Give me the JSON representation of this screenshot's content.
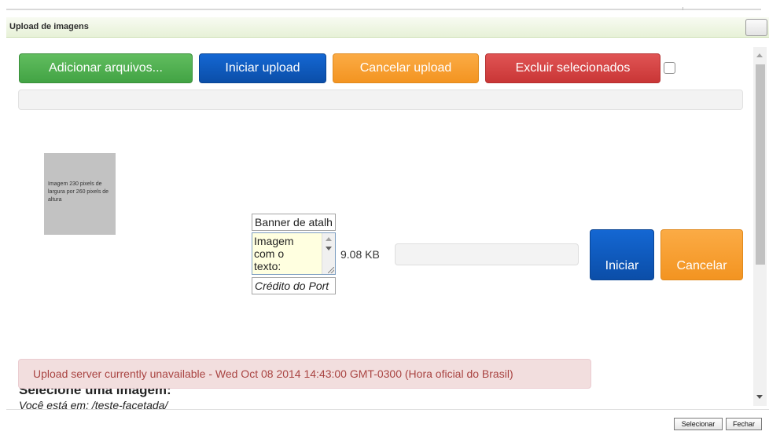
{
  "dialog": {
    "title": "Upload de imagens"
  },
  "toolbar": {
    "add_label": "Adicionar arquivos...",
    "start_label": "Iniciar upload",
    "cancel_label": "Cancelar upload",
    "delete_label": "Excluir selecionados",
    "select_all_checked": false
  },
  "file": {
    "thumbnail_text": "Imagem 230 pixels de largura por 260 pixels de altura",
    "title_value": "Banner de atalh",
    "description_value": "Imagem\ncom o\ntexto:",
    "credit_value": "Crédito do Port",
    "size": "9.08 KB",
    "progress": 0,
    "start_label": "Iniciar",
    "cancel_label": "Cancelar"
  },
  "alert": {
    "message": "Upload server currently unavailable - Wed Oct 08 2014 14:43:00 GMT-0300 (Hora oficial do Brasil)"
  },
  "background": {
    "heading": "Selecione uma imagem:",
    "location": "Você está em: /teste-facetada/"
  },
  "footer": {
    "select_label": "Selecionar",
    "close_label": "Fechar"
  },
  "colors": {
    "green": "#4cae4c",
    "blue": "#0e58bd",
    "orange": "#f89a2a",
    "red": "#d04242",
    "alert_bg": "#f2dede",
    "alert_text": "#a94442"
  },
  "icons": {
    "dialog_close": "square-close-icon",
    "scroll_up": "triangle-up-icon",
    "scroll_down": "triangle-down-icon"
  }
}
